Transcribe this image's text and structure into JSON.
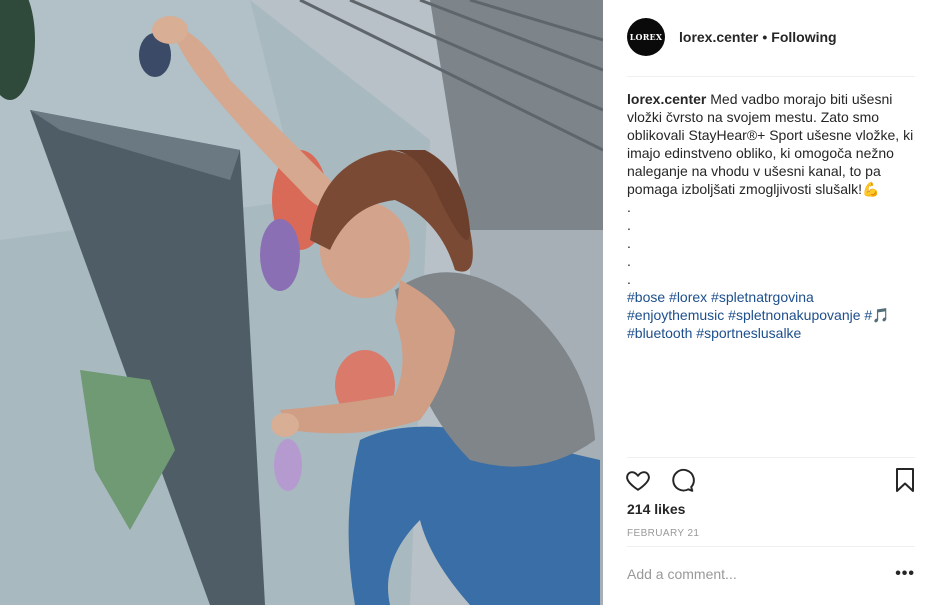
{
  "post": {
    "username": "lorex.center",
    "avatar_text": "LOREX",
    "separator": "•",
    "follow_status": "Following",
    "caption": {
      "text": "Med vadbo morajo biti ušesni vložki čvrsto na svojem mestu. Zato smo oblikovali StayHear®+ Sport ušesne vložke, ki imajo edinstveno obliko, ki omogoča nežno naleganje na vhodu v ušesni kanal, to pa pomaga izboljšati zmogljivosti slušalk!💪",
      "dots": [
        ".",
        ".",
        ".",
        ".",
        "."
      ],
      "hashtags_line1": "#bose #lorex #spletnatrgovina",
      "hashtags_line2": "#enjoythemusic #spletnonakupovanje #🎵",
      "hashtags_line3": "#bluetooth #sportneslusalke"
    },
    "likes": "214 likes",
    "date": "FEBRUARY 21",
    "comment_placeholder": "Add a comment...",
    "more_label": "•••"
  },
  "icons": {
    "like": "heart-icon",
    "comment": "comment-bubble-icon",
    "save": "bookmark-icon",
    "options": "more-options-icon"
  }
}
